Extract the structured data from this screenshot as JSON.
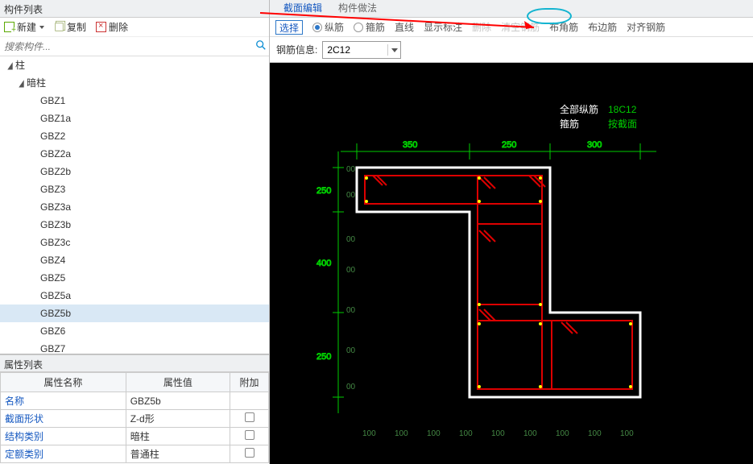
{
  "left": {
    "panel_title": "构件列表",
    "toolbar": {
      "new_label": "新建",
      "copy_label": "复制",
      "delete_label": "删除"
    },
    "search_placeholder": "搜索构件...",
    "tree": {
      "root_label": "柱",
      "category_label": "暗柱",
      "items": [
        "GBZ1",
        "GBZ1a",
        "GBZ2",
        "GBZ2a",
        "GBZ2b",
        "GBZ3",
        "GBZ3a",
        "GBZ3b",
        "GBZ3c",
        "GBZ4",
        "GBZ5",
        "GBZ5a",
        "GBZ5b",
        "GBZ6",
        "GBZ7"
      ],
      "selected": "GBZ5b"
    },
    "prop_panel_title": "属性列表",
    "prop_headers": [
      "属性名称",
      "属性值",
      "附加"
    ],
    "props": [
      {
        "name": "名称",
        "value": "GBZ5b",
        "link": true,
        "check": false
      },
      {
        "name": "截面形状",
        "value": "Z-d形",
        "link": true,
        "check": true
      },
      {
        "name": "结构类别",
        "value": "暗柱",
        "link": true,
        "check": true
      },
      {
        "name": "定额类别",
        "value": "普通柱",
        "link": true,
        "check": true
      }
    ]
  },
  "right": {
    "tabs": [
      "截面编辑",
      "构件做法"
    ],
    "options": {
      "select": "选择",
      "zongjin": "纵筋",
      "gujin": "箍筋",
      "zhixian": "直线",
      "xianshibiaozhu": "显示标注",
      "shanchu": "删除",
      "qingkonggangjin": "清空钢筋",
      "bujiaojin": "布角筋",
      "bubianjin": "布边筋",
      "duiqigangjin": "对齐钢筋"
    },
    "rebar_label": "钢筋信息:",
    "rebar_value": "2C12",
    "legend": {
      "row1_a": "全部纵筋",
      "row1_b": "18C12",
      "row2_a": "箍筋",
      "row2_b": "按截面"
    }
  },
  "chart_data": {
    "type": "diagram",
    "title": "Z-d形 column cross-section",
    "top_dims": [
      350,
      250,
      300
    ],
    "left_dims": [
      250,
      400,
      250
    ],
    "bottom_dims": [
      100,
      100,
      100,
      100,
      100,
      100,
      100,
      100,
      100
    ],
    "left_tick_rows": 6,
    "rebar_info": "18C12",
    "stirrup_info": "按截面",
    "shape_points_top_to_bottom": "Z-d (S-shaped) composite column outline"
  }
}
